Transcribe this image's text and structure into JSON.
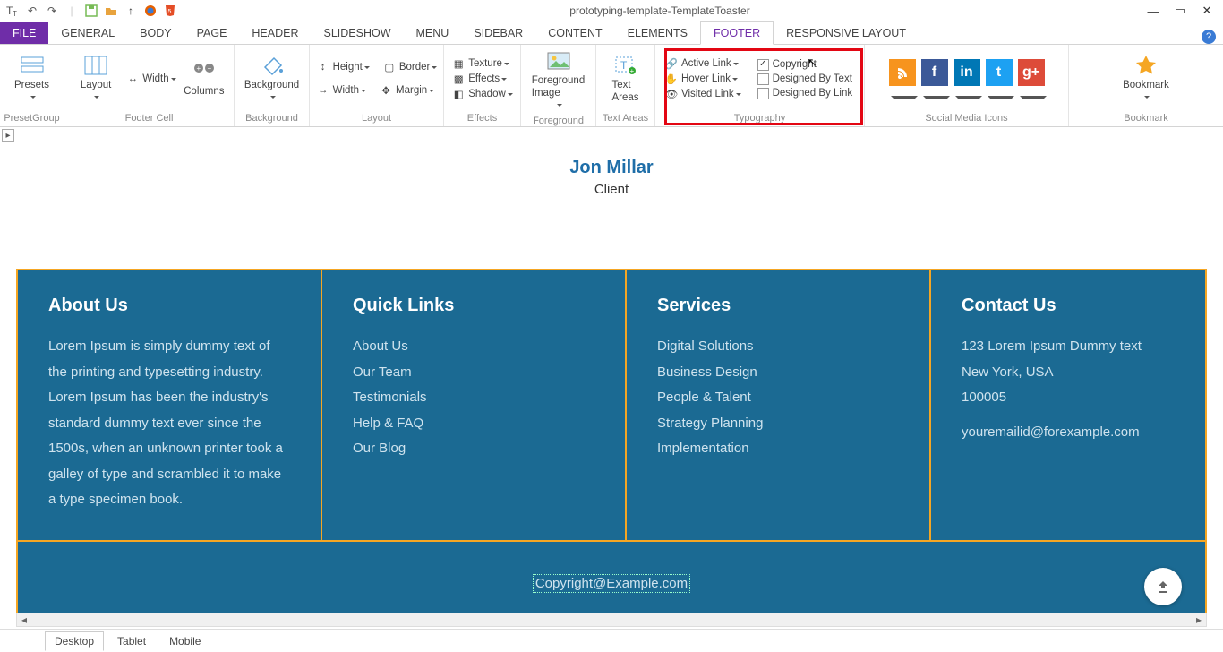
{
  "window": {
    "title": "prototyping-template-TemplateToaster"
  },
  "tabs": {
    "file": "FILE",
    "items": [
      "GENERAL",
      "BODY",
      "PAGE",
      "HEADER",
      "SLIDESHOW",
      "MENU",
      "SIDEBAR",
      "CONTENT",
      "ELEMENTS",
      "FOOTER",
      "RESPONSIVE LAYOUT"
    ],
    "active": "FOOTER"
  },
  "ribbon": {
    "presets": {
      "label": "Presets",
      "group": "PresetGroup"
    },
    "footer_cell": {
      "layout": "Layout",
      "width": "Width",
      "columns": "Columns",
      "group": "Footer Cell"
    },
    "background": {
      "label": "Background",
      "group": "Background"
    },
    "layout": {
      "height": "Height",
      "border": "Border",
      "width": "Width",
      "margin": "Margin",
      "group": "Layout"
    },
    "effects": {
      "texture": "Texture",
      "effects": "Effects",
      "shadow": "Shadow",
      "group": "Effects"
    },
    "foreground": {
      "label": "Foreground\nImage",
      "group": "Foreground"
    },
    "text_areas": {
      "label": "Text\nAreas",
      "group": "Text Areas"
    },
    "typography": {
      "active_link": "Active Link",
      "hover_link": "Hover Link",
      "visited_link": "Visited Link",
      "copyright": "Copyright",
      "designed_text": "Designed By Text",
      "designed_link": "Designed By Link",
      "group": "Typography"
    },
    "social": {
      "group": "Social Media Icons"
    },
    "bookmark": {
      "label": "Bookmark",
      "group": "Bookmark"
    }
  },
  "canvas": {
    "person_name": "Jon Millar",
    "person_role": "Client",
    "footer": {
      "about": {
        "title": "About Us",
        "body": "Lorem Ipsum is simply dummy text of the printing and typesetting industry. Lorem Ipsum has been the industry's standard dummy text ever since the 1500s, when an unknown printer took a galley of type and scrambled it to make a type specimen book."
      },
      "quick": {
        "title": "Quick Links",
        "items": [
          "About Us",
          "Our Team",
          "Testimonials",
          "Help & FAQ",
          "Our Blog"
        ]
      },
      "services": {
        "title": "Services",
        "items": [
          "Digital Solutions",
          "Business Design",
          "People & Talent",
          "Strategy Planning",
          "Implementation"
        ]
      },
      "contact": {
        "title": "Contact Us",
        "addr1": "123 Lorem Ipsum Dummy text",
        "addr2": "New York, USA",
        "addr3": "100005",
        "email": "youremailid@forexample.com"
      },
      "copyright": "Copyright@Example.com"
    }
  },
  "device_tabs": [
    "Desktop",
    "Tablet",
    "Mobile"
  ]
}
